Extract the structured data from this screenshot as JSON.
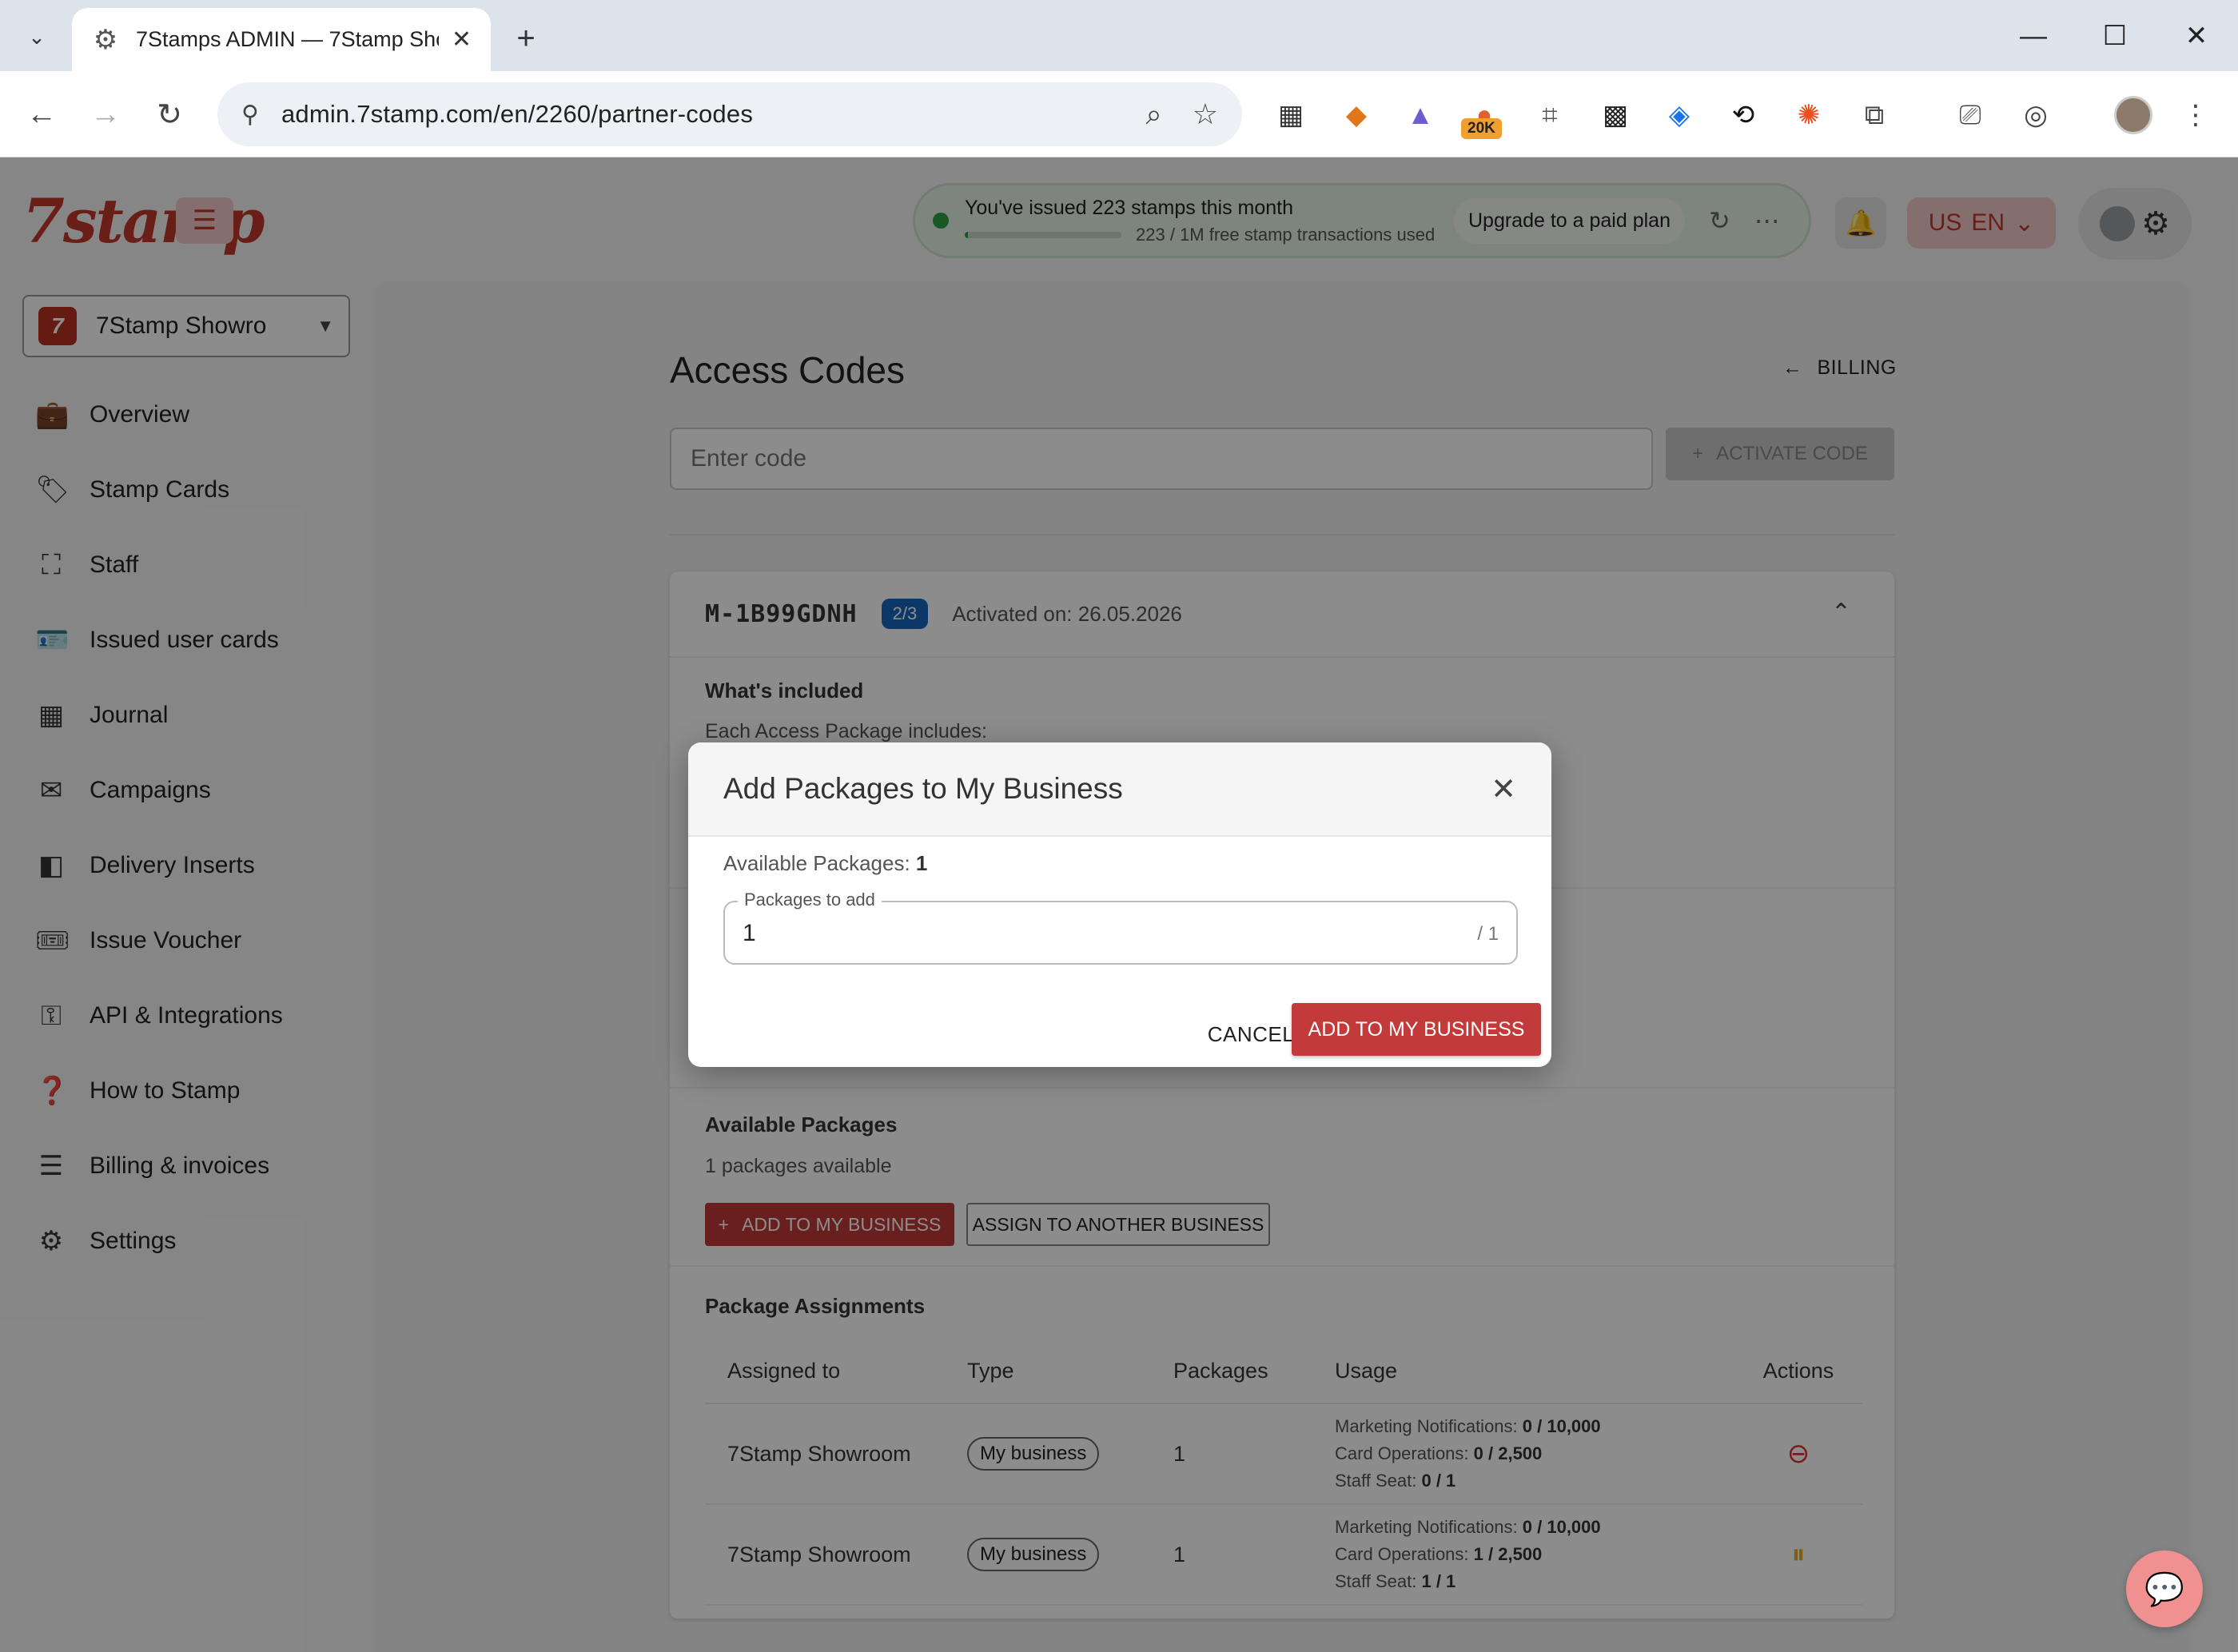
{
  "browser": {
    "tab_title": "7Stamps ADMIN — 7Stamp Sho",
    "url": "admin.7stamp.com/en/2260/partner-codes",
    "extension_badge": "20K"
  },
  "header": {
    "logo": "7stamp",
    "stats_title": "You've issued 223 stamps this month",
    "stats_sub": "223 / 1M free stamp transactions used",
    "stats_progress": 0.02,
    "upgrade_label": "Upgrade to a paid plan",
    "lang_flag": "US",
    "lang_code": "EN"
  },
  "business_selector": {
    "name": "7Stamp Showro",
    "logo_letter": "7"
  },
  "sidebar": {
    "items": [
      {
        "label": "Overview",
        "icon": "briefcase-icon"
      },
      {
        "label": "Stamp Cards",
        "icon": "tag-icon"
      },
      {
        "label": "Staff",
        "icon": "scan-icon"
      },
      {
        "label": "Issued user cards",
        "icon": "id-card-icon"
      },
      {
        "label": "Journal",
        "icon": "table-icon"
      },
      {
        "label": "Campaigns",
        "icon": "mail-icon"
      },
      {
        "label": "Delivery Inserts",
        "icon": "inserts-icon"
      },
      {
        "label": "Issue Voucher",
        "icon": "ticket-icon"
      },
      {
        "label": "API & Integrations",
        "icon": "key-icon"
      },
      {
        "label": "How to Stamp",
        "icon": "help-icon"
      },
      {
        "label": "Billing & invoices",
        "icon": "receipt-icon"
      },
      {
        "label": "Settings",
        "icon": "gear-icon"
      }
    ]
  },
  "page": {
    "title": "Access Codes",
    "billing_link": "BILLING",
    "code_placeholder": "Enter code",
    "activate_label": "ACTIVATE CODE"
  },
  "code_card": {
    "code": "M-1B99GDNH",
    "badge": "2/3",
    "activated": "Activated on: 26.05.2026",
    "included_title": "What's included",
    "included_sub": "Each Access Package includes:",
    "available_title": "Available Packages",
    "available_sub": "1 packages available",
    "add_label": "ADD TO MY BUSINESS",
    "assign_label": "ASSIGN TO ANOTHER BUSINESS",
    "assignments_title": "Package Assignments",
    "columns": [
      "Assigned to",
      "Type",
      "Packages",
      "Usage",
      "Actions"
    ],
    "rows": [
      {
        "assigned_to": "7Stamp Showroom",
        "type": "My business",
        "packages": "1",
        "usage": [
          {
            "label": "Marketing Notifications:",
            "value": "0 / 10,000"
          },
          {
            "label": "Card Operations:",
            "value": "0 / 2,500"
          },
          {
            "label": "Staff Seat:",
            "value": "0 / 1"
          }
        ]
      },
      {
        "assigned_to": "7Stamp Showroom",
        "type": "My business",
        "packages": "1",
        "usage": [
          {
            "label": "Marketing Notifications:",
            "value": "0 / 10,000"
          },
          {
            "label": "Card Operations:",
            "value": "1 / 2,500"
          },
          {
            "label": "Staff Seat:",
            "value": "1 / 1"
          }
        ]
      }
    ]
  },
  "modal": {
    "title": "Add Packages to My Business",
    "available_label": "Available Packages:",
    "available_value": "1",
    "field_label": "Packages to add",
    "field_value": "1",
    "field_max": "/ 1",
    "cancel_label": "CANCEL",
    "confirm_label": "ADD TO MY BUSINESS"
  },
  "colors": {
    "brand_red": "#c23a3a",
    "badge_blue": "#1565c0",
    "status_green": "#2e9e44"
  }
}
